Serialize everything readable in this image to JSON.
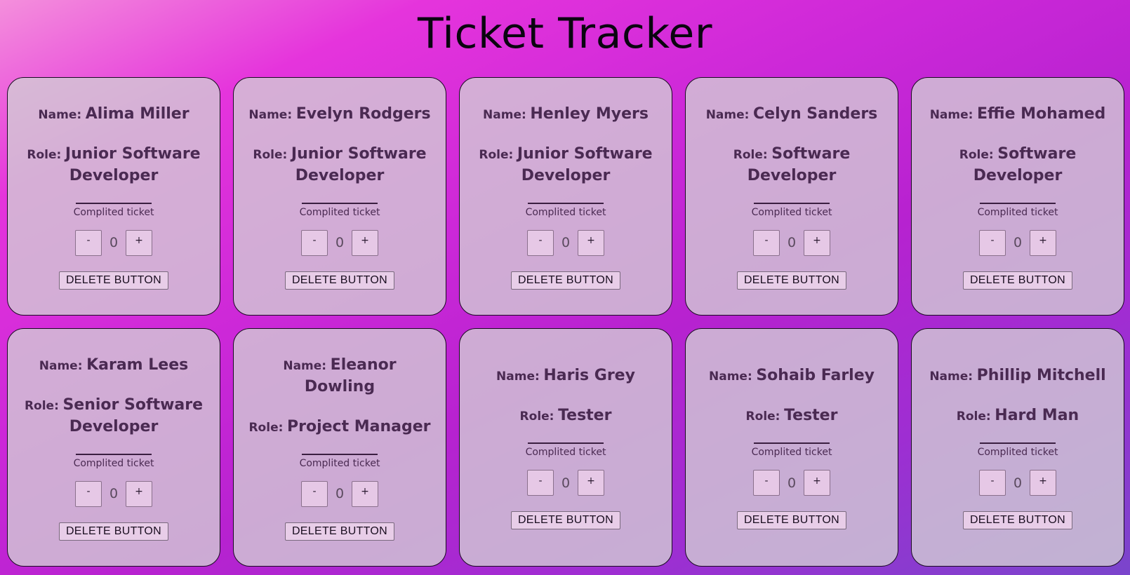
{
  "header": {
    "title": "Ticket Tracker"
  },
  "labels": {
    "name": "Name:",
    "role": "Role:",
    "completed": "Complited ticket",
    "minus": "-",
    "plus": "+",
    "delete": "DELETE BUTTON"
  },
  "employees": [
    {
      "name": "Alima Miller",
      "role": "Junior Software Developer",
      "tickets": "0"
    },
    {
      "name": "Evelyn Rodgers",
      "role": "Junior Software Developer",
      "tickets": "0"
    },
    {
      "name": "Henley Myers",
      "role": "Junior Software Developer",
      "tickets": "0"
    },
    {
      "name": "Celyn Sanders",
      "role": "Software Developer",
      "tickets": "0"
    },
    {
      "name": "Effie Mohamed",
      "role": "Software Developer",
      "tickets": "0"
    },
    {
      "name": "Karam Lees",
      "role": "Senior Software Developer",
      "tickets": "0"
    },
    {
      "name": "Eleanor Dowling",
      "role": "Project Manager",
      "tickets": "0"
    },
    {
      "name": "Haris Grey",
      "role": "Tester",
      "tickets": "0"
    },
    {
      "name": "Sohaib Farley",
      "role": "Tester",
      "tickets": "0"
    },
    {
      "name": "Phillip Mitchell",
      "role": "Hard Man",
      "tickets": "0"
    }
  ]
}
